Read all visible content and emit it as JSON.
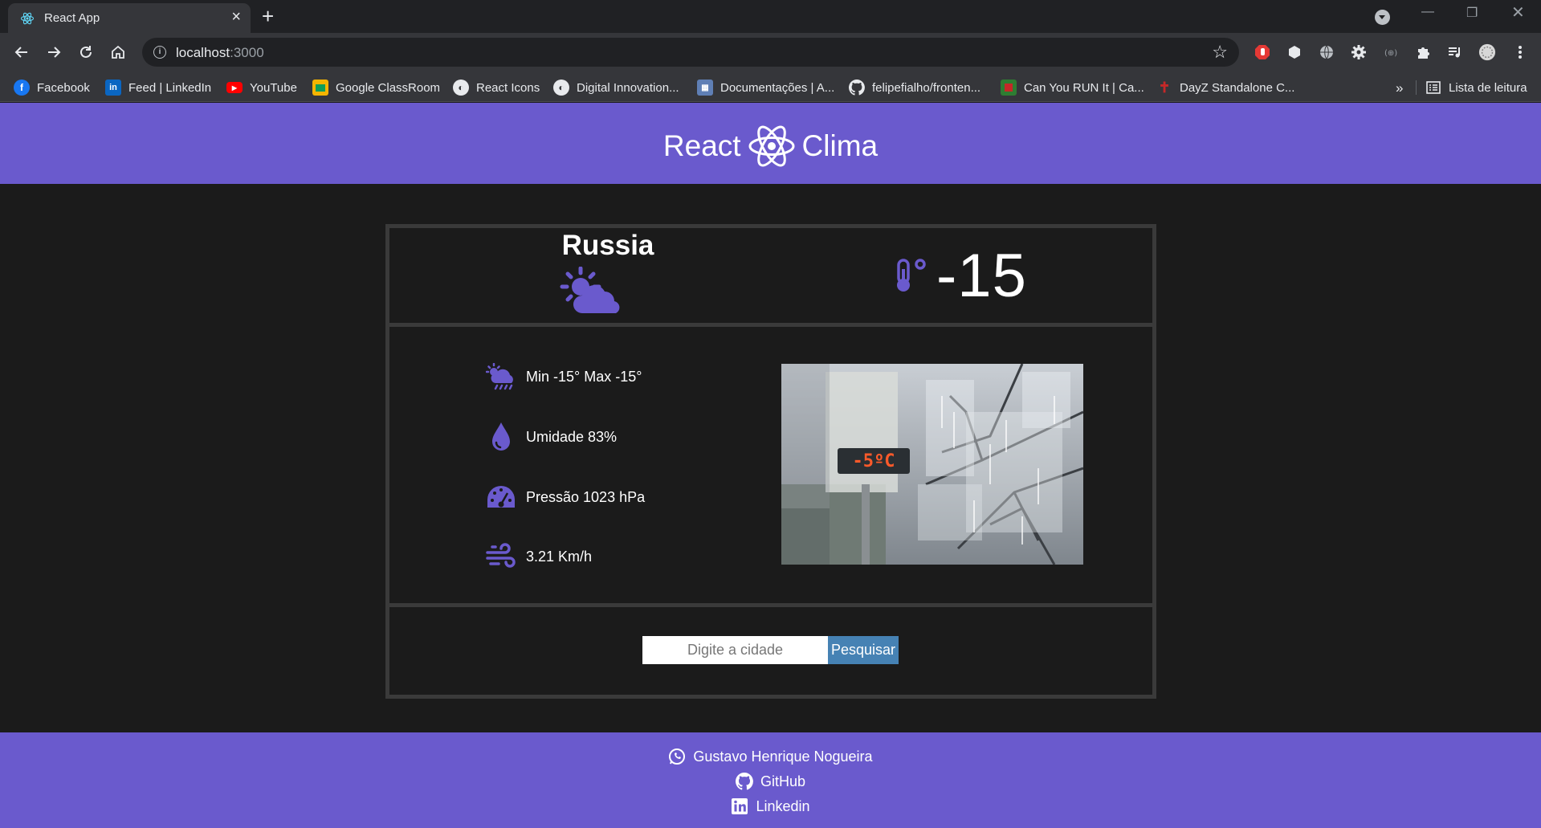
{
  "browser": {
    "tab_title": "React App",
    "url_host": "localhost",
    "url_port": ":3000",
    "bookmarks": [
      {
        "label": "Facebook",
        "icon": "facebook-icon",
        "color": "#1877f2"
      },
      {
        "label": "Feed | LinkedIn",
        "icon": "linkedin-icon",
        "color": "#0a66c2"
      },
      {
        "label": "YouTube",
        "icon": "youtube-icon",
        "color": "#ff0000"
      },
      {
        "label": "Google ClassRoom",
        "icon": "classroom-icon",
        "color": "#f4b400"
      },
      {
        "label": "React Icons",
        "icon": "globe-icon",
        "color": "#e8eaed"
      },
      {
        "label": "Digital Innovation...",
        "icon": "globe-icon",
        "color": "#e8eaed"
      },
      {
        "label": "Documentações | A...",
        "icon": "docs-icon",
        "color": "#8ab4f8"
      },
      {
        "label": "felipefialho/fronten...",
        "icon": "github-icon",
        "color": "#e8eaed"
      },
      {
        "label": "Can You RUN It | Ca...",
        "icon": "canyourunit-icon",
        "color": "#c62828"
      },
      {
        "label": "DayZ Standalone C...",
        "icon": "dayz-icon",
        "color": "#b71c1c"
      }
    ],
    "reading_list": "Lista de leitura"
  },
  "app": {
    "logo_left": "React",
    "logo_right": "Clima",
    "accent": "#6a5acd"
  },
  "weather": {
    "city": "Russia",
    "temperature": "-15",
    "condition_icon": "partly-cloudy-icon",
    "stats": [
      {
        "icon": "rain-cloud-icon",
        "text": "Min -15° Max -15°"
      },
      {
        "icon": "water-drop-icon",
        "text": "Umidade 83%"
      },
      {
        "icon": "gauge-icon",
        "text": "Pressão 1023 hPa"
      },
      {
        "icon": "wind-icon",
        "text": "3.21 Km/h"
      }
    ],
    "photo_thermometer_text": "-5ºC"
  },
  "search": {
    "placeholder": "Digite a cidade",
    "button_label": "Pesquisar"
  },
  "footer": {
    "author": "Gustavo Henrique Nogueira",
    "github": "GitHub",
    "linkedin": "Linkedin"
  }
}
